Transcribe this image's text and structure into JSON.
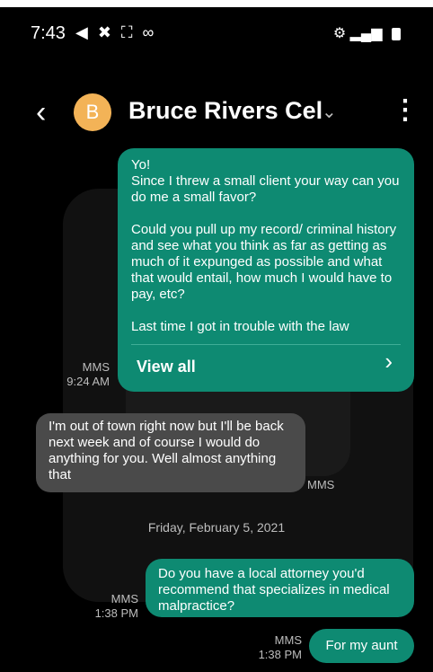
{
  "status_bar": {
    "time": "7:43",
    "left_icons": "◀ ✖ ⛶ ∞",
    "right_icons": "⚙ ▂▄▆"
  },
  "header": {
    "back_icon": "‹",
    "avatar_letter": "B",
    "contact_name": "Bruce Rivers Cel",
    "name_chevron": "⌄",
    "more_icon": "⋮"
  },
  "messages": [
    {
      "type": "sent",
      "text": "Yo!\nSince I threw a small client your way can you do me a small favor?\n\nCould you pull up my record/ criminal history and see what you think as far as getting as much of it expunged as possible and what that would entail,  how much I would have to pay,  etc?\n\nLast time I got in trouble with the law",
      "action_label": "View all",
      "action_icon": "›",
      "meta_type": "MMS",
      "meta_time": "9:24 AM"
    },
    {
      "type": "received",
      "text": "I'm out of town right now but I'll be back next week and of course I would do anything for you.  Well almost anything that",
      "meta_type": "MMS"
    },
    {
      "type": "sent",
      "text": "Do you have a local attorney you'd recommend that specializes in medical malpractice?",
      "meta_type": "MMS",
      "meta_time": "1:38 PM"
    },
    {
      "type": "sent",
      "text": "For my aunt",
      "meta_type": "MMS",
      "meta_time": "1:38 PM"
    }
  ],
  "date_separator": "Friday, February 5, 2021",
  "colors": {
    "sent_bubble": "#0e8a72",
    "received_bubble": "#4a4a4a",
    "avatar": "#f3b357"
  }
}
